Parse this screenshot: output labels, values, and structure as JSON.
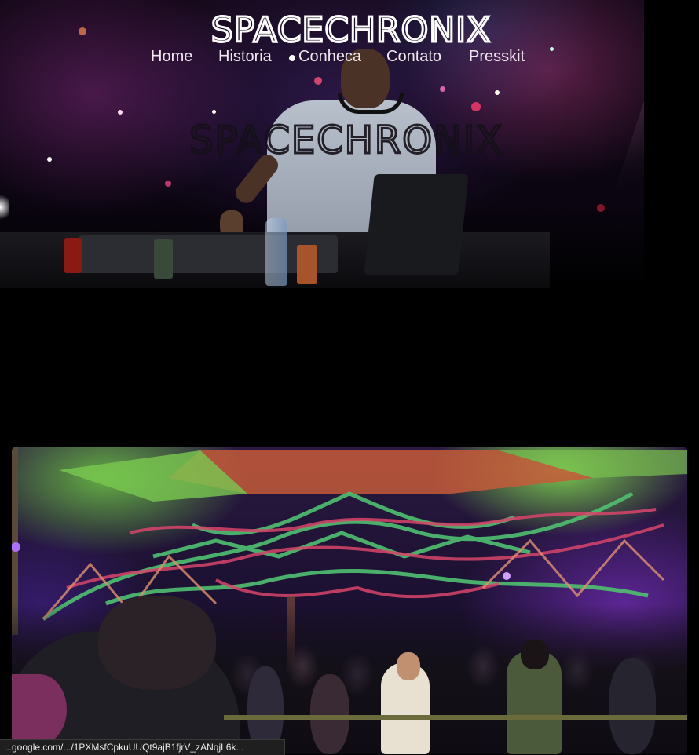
{
  "header": {
    "logo_text": "SPACECHRONIX"
  },
  "nav": {
    "items": [
      {
        "label": "Home"
      },
      {
        "label": "Historia"
      },
      {
        "label": "Conheca"
      },
      {
        "label": "Contato"
      },
      {
        "label": "Presskit"
      }
    ]
  },
  "hero": {
    "overlay_logo_text": "SPACECHRONIX"
  },
  "status_bar": {
    "url": "...google.com/.../1PXMsfCpkuUUQt9ajB1fjrV_zANqjL6k..."
  },
  "colors": {
    "background": "#000000",
    "nav_text": "#f2e8ee"
  }
}
